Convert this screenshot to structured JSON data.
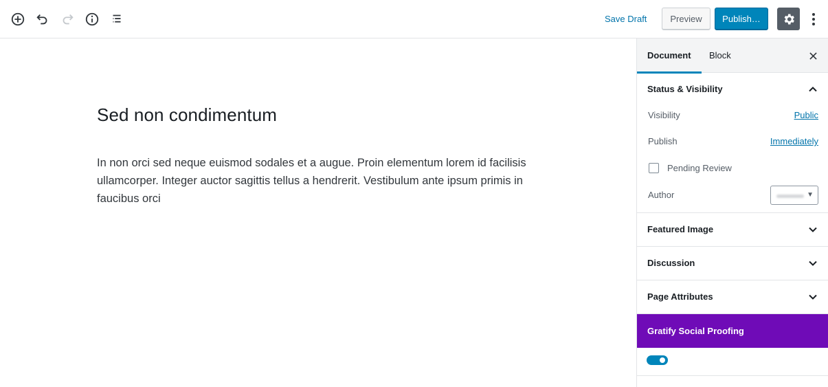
{
  "toolbar": {
    "save_draft": "Save Draft",
    "preview": "Preview",
    "publish": "Publish…",
    "icons": [
      "add-block-icon",
      "undo-icon",
      "redo-icon",
      "info-icon",
      "outline-icon",
      "gear-icon",
      "more-vertical-icon"
    ]
  },
  "post": {
    "title": "Sed non condimentum",
    "paragraph": "In non orci sed neque euismod sodales et a augue. Proin elementum lorem id facilisis ullamcorper. Integer auctor sagittis tellus a hendrerit. Vestibulum ante ipsum primis in faucibus orci"
  },
  "sidebar": {
    "tabs": [
      {
        "label": "Document",
        "active": true
      },
      {
        "label": "Block",
        "active": false
      }
    ],
    "status": {
      "title": "Status & Visibility",
      "visibility_label": "Visibility",
      "visibility_value": "Public",
      "publish_label": "Publish",
      "publish_value": "Immediately",
      "pending_review": "Pending Review",
      "author_label": "Author"
    },
    "panels": {
      "featured": "Featured Image",
      "discussion": "Discussion",
      "attributes": "Page Attributes"
    },
    "gratify": {
      "title": "Gratify Social Proofing",
      "color": "#6f0bb7",
      "toggle_on": true
    }
  },
  "colors": {
    "accent": "#0085ba",
    "link": "#0073aa",
    "gratify": "#6f0bb7"
  }
}
